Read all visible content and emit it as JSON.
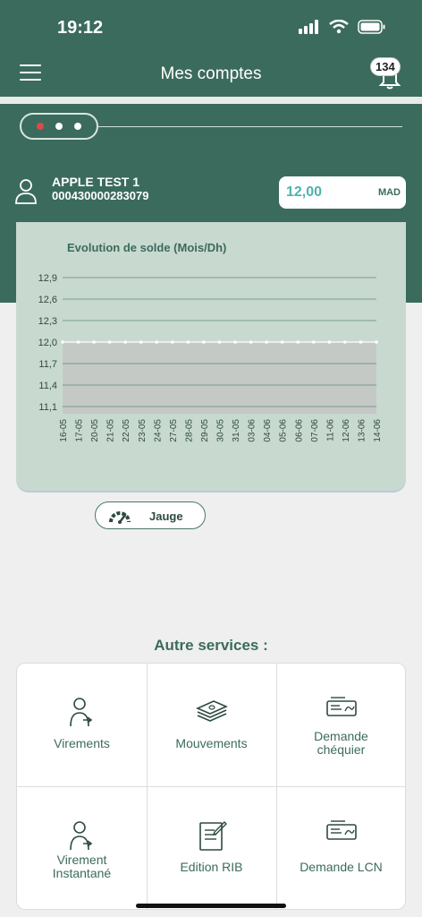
{
  "status_bar": {
    "time": "19:12"
  },
  "header": {
    "title": "Mes comptes",
    "notification_count": "134"
  },
  "pager": {
    "pages": 3,
    "active_index": 0
  },
  "account": {
    "name": "APPLE TEST 1",
    "number": "000430000283079",
    "balance": "12,00",
    "currency": "MAD"
  },
  "chart_data": {
    "type": "area",
    "title": "Evolution de solde (Mois/Dh)",
    "y_ticks": [
      "12,9",
      "12,6",
      "12,3",
      "12,0",
      "11,7",
      "11,4",
      "11,1"
    ],
    "x": [
      "16-05",
      "17-05",
      "20-05",
      "21-05",
      "22-05",
      "23-05",
      "24-05",
      "27-05",
      "28-05",
      "29-05",
      "30-05",
      "31-05",
      "03-06",
      "04-06",
      "05-06",
      "06-06",
      "07-06",
      "11-06",
      "12-06",
      "13-06",
      "14-06"
    ],
    "values": [
      12,
      12,
      12,
      12,
      12,
      12,
      12,
      12,
      12,
      12,
      12,
      12,
      12,
      12,
      12,
      12,
      12,
      12,
      12,
      12,
      12
    ],
    "ylim": [
      11.0,
      12.9
    ],
    "colors": {
      "line": "#ffffff",
      "area": "#c5c9c6",
      "grid": "#5e8c7a",
      "text": "#2d4a40"
    }
  },
  "jauge_button": {
    "label": "Jauge"
  },
  "services": {
    "title": "Autre services :",
    "items": [
      {
        "label": "Virements",
        "icon": "person-transfer-icon"
      },
      {
        "label": "Mouvements",
        "icon": "money-stack-icon"
      },
      {
        "label": "Demande\nchéquier",
        "icon": "cheque-icon"
      },
      {
        "label": "Virement\nInstantané",
        "icon": "person-transfer-icon"
      },
      {
        "label": "Edition RIB",
        "icon": "document-edit-icon"
      },
      {
        "label": "Demande LCN",
        "icon": "cheque-icon"
      }
    ]
  },
  "theme": {
    "primary": "#3b6b5c",
    "accent": "#4fb3a9",
    "pager_active": "#e04848"
  }
}
